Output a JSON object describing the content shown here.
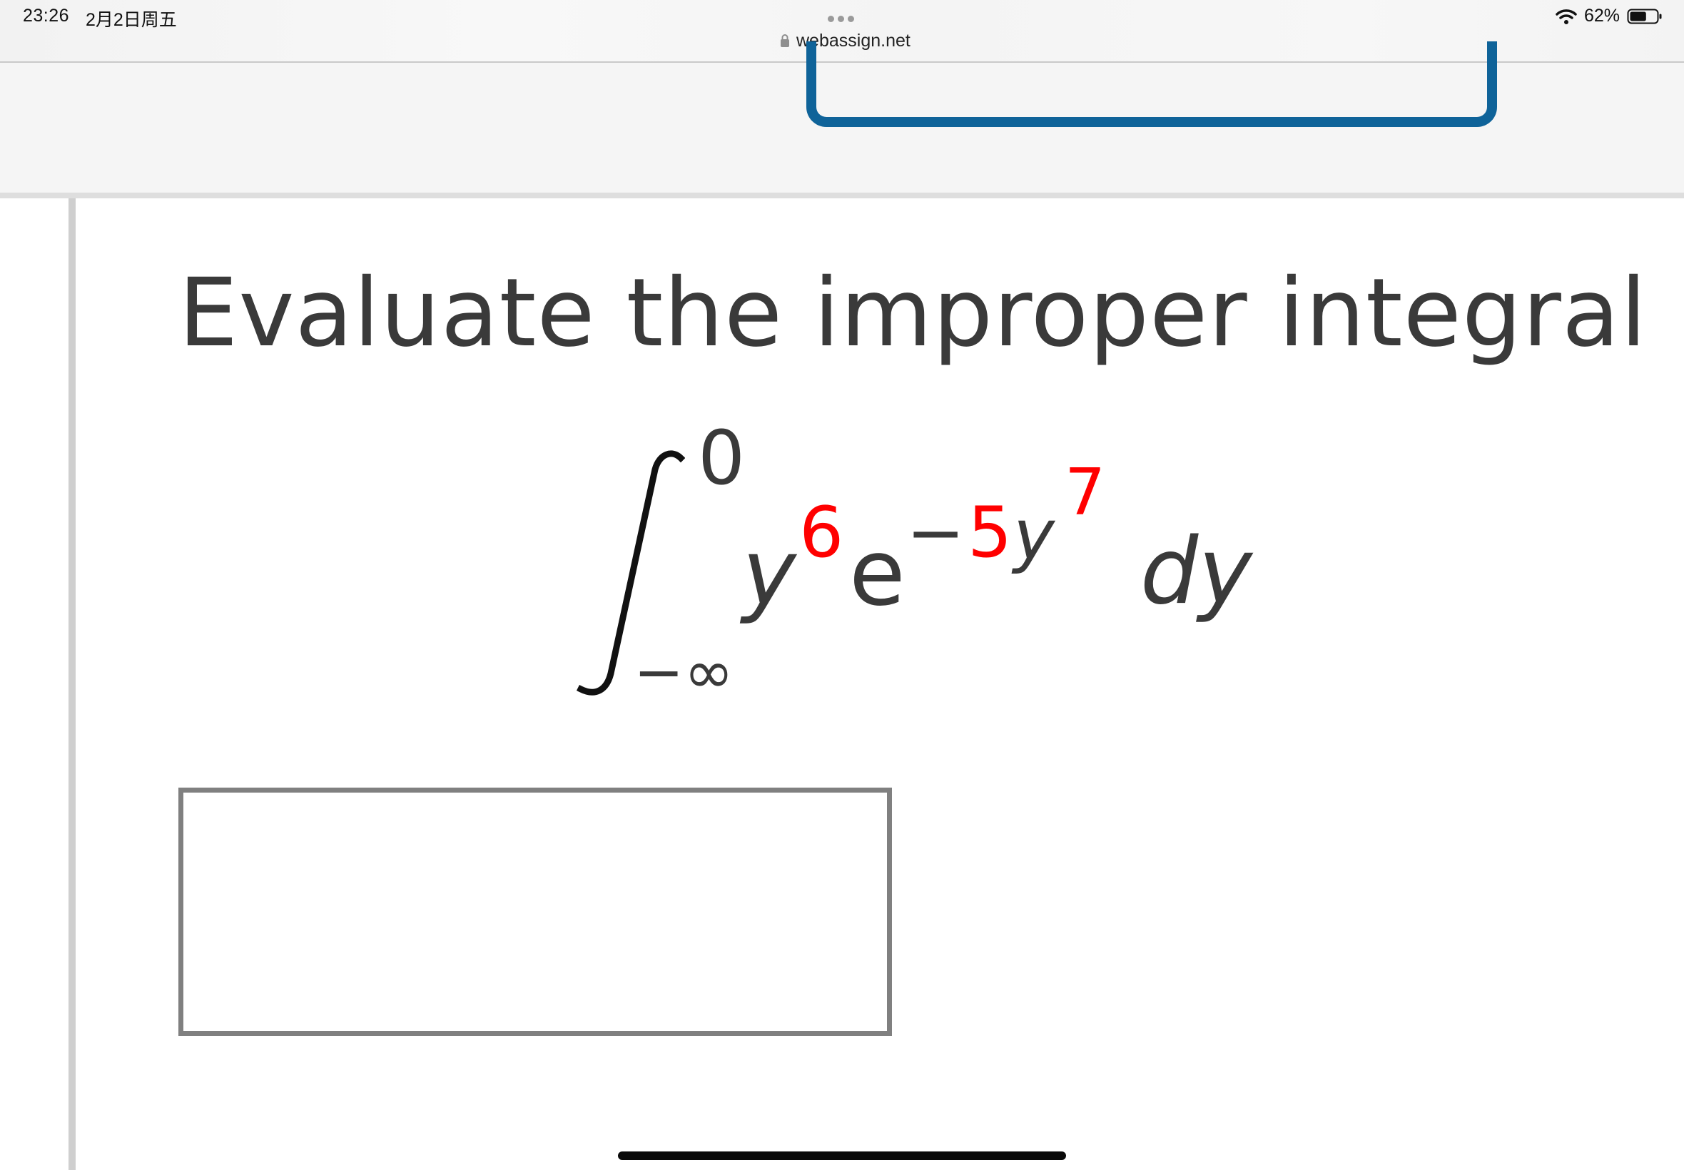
{
  "status_bar": {
    "time": "23:26",
    "date": "2月2日周五",
    "battery_percent": "62%",
    "battery_level": 0.62,
    "wifi_icon": "wifi-icon",
    "battery_icon": "battery-icon"
  },
  "browser": {
    "url": "webassign.net",
    "lock_icon": "lock-icon",
    "tab_dots_icon": "more-dots-icon"
  },
  "question": {
    "prompt": "Evaluate the improper integral (i"
  },
  "integral": {
    "upper_limit": "0",
    "lower_limit": "−∞",
    "base_var": "y",
    "base_exponent": "6",
    "exp_base": "e",
    "exp_sign": "−",
    "exp_coefficient": "5",
    "exp_var": "y",
    "exp_var_power": "7",
    "differential": "dy"
  },
  "answer": {
    "value": ""
  },
  "colors": {
    "accent_blue": "#0f6399",
    "highlight_red": "#ff0000",
    "text_dark": "#3a3a3a",
    "input_border": "#808080"
  }
}
